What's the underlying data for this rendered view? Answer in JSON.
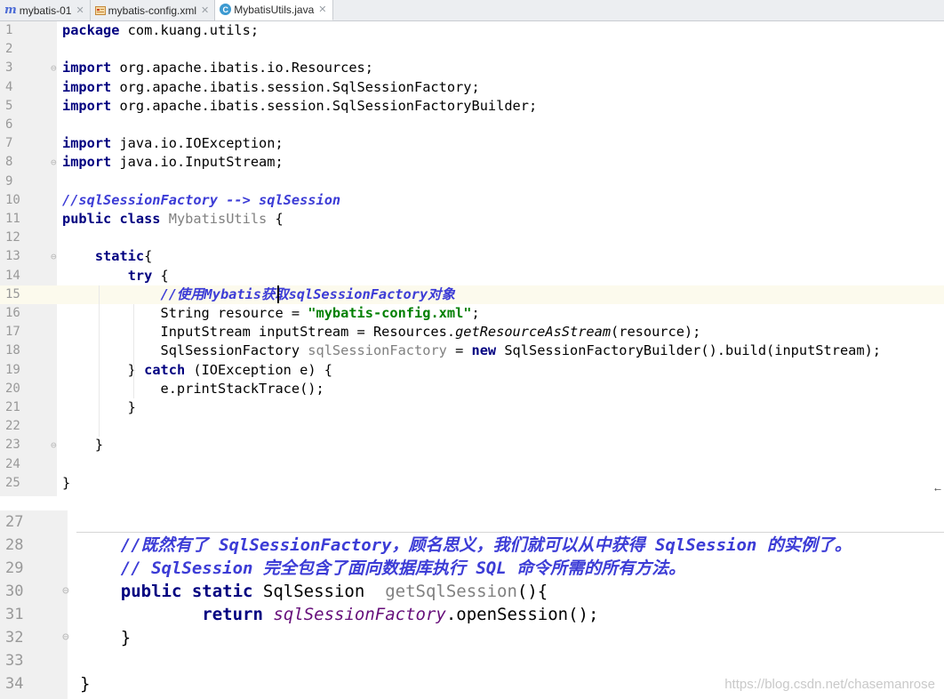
{
  "tabs": [
    {
      "label": "mybatis-01",
      "icon": "module-icon"
    },
    {
      "label": "mybatis-config.xml",
      "icon": "xml-file-icon"
    },
    {
      "label": "MybatisUtils.java",
      "icon": "java-class-icon",
      "active": true
    }
  ],
  "editor1": {
    "highlighted_line": "15",
    "lines": [
      {
        "n": "1",
        "tokens": [
          [
            "kw",
            "package"
          ],
          [
            "",
            " com.kuang.utils;"
          ]
        ]
      },
      {
        "n": "2",
        "tokens": []
      },
      {
        "n": "3",
        "fold": true,
        "tokens": [
          [
            "kw",
            "import"
          ],
          [
            "",
            " org.apache.ibatis.io.Resources;"
          ]
        ]
      },
      {
        "n": "4",
        "tokens": [
          [
            "kw",
            "import"
          ],
          [
            "",
            " org.apache.ibatis.session.SqlSessionFactory;"
          ]
        ]
      },
      {
        "n": "5",
        "tokens": [
          [
            "kw",
            "import"
          ],
          [
            "",
            " org.apache.ibatis.session.SqlSessionFactoryBuilder;"
          ]
        ]
      },
      {
        "n": "6",
        "tokens": []
      },
      {
        "n": "7",
        "tokens": [
          [
            "kw",
            "import"
          ],
          [
            "",
            " java.io.IOException;"
          ]
        ]
      },
      {
        "n": "8",
        "fold": true,
        "tokens": [
          [
            "kw",
            "import"
          ],
          [
            "",
            " java.io.InputStream;"
          ]
        ]
      },
      {
        "n": "9",
        "tokens": []
      },
      {
        "n": "10",
        "tokens": [
          [
            "cmt",
            "//sqlSessionFactory --> sqlSession"
          ]
        ]
      },
      {
        "n": "11",
        "tokens": [
          [
            "kw",
            "public class"
          ],
          [
            "",
            " "
          ],
          [
            "gray",
            "MybatisUtils"
          ],
          [
            "",
            " {"
          ]
        ]
      },
      {
        "n": "12",
        "tokens": []
      },
      {
        "n": "13",
        "fold": true,
        "tokens": [
          [
            "",
            "    "
          ],
          [
            "kw",
            "static"
          ],
          [
            "",
            "{"
          ]
        ]
      },
      {
        "n": "14",
        "tokens": [
          [
            "",
            "        "
          ],
          [
            "kw",
            "try"
          ],
          [
            "",
            " {"
          ]
        ]
      },
      {
        "n": "15",
        "tokens": [
          [
            "",
            "            "
          ],
          [
            "cmt",
            "//使用Mybatis获取sqlSessionFactory对象"
          ]
        ]
      },
      {
        "n": "16",
        "tokens": [
          [
            "",
            "            String resource = "
          ],
          [
            "str",
            "\"mybatis-config.xml\""
          ],
          [
            "",
            ";"
          ]
        ]
      },
      {
        "n": "17",
        "tokens": [
          [
            "",
            "            InputStream inputStream = Resources."
          ],
          [
            "ital",
            "getResourceAsStream"
          ],
          [
            "",
            "(resource);"
          ]
        ]
      },
      {
        "n": "18",
        "tokens": [
          [
            "",
            "            SqlSessionFactory "
          ],
          [
            "gray",
            "sqlSessionFactory"
          ],
          [
            "",
            " = "
          ],
          [
            "kw",
            "new"
          ],
          [
            "",
            " SqlSessionFactoryBuilder().build(inputStream);"
          ]
        ]
      },
      {
        "n": "19",
        "tokens": [
          [
            "",
            "        } "
          ],
          [
            "kw",
            "catch"
          ],
          [
            "",
            " (IOException e) {"
          ]
        ]
      },
      {
        "n": "20",
        "tokens": [
          [
            "",
            "            e.printStackTrace();"
          ]
        ]
      },
      {
        "n": "21",
        "tokens": [
          [
            "",
            "        }"
          ]
        ]
      },
      {
        "n": "22",
        "tokens": []
      },
      {
        "n": "23",
        "fold": true,
        "tokens": [
          [
            "",
            "    }"
          ]
        ]
      },
      {
        "n": "24",
        "tokens": []
      },
      {
        "n": "25",
        "tokens": [
          [
            "",
            "}"
          ]
        ]
      }
    ]
  },
  "editor2": {
    "lines": [
      {
        "n": "27",
        "tokens": []
      },
      {
        "n": "28",
        "tokens": [
          [
            "",
            "    "
          ],
          [
            "cmt",
            "//既然有了 SqlSessionFactory，顾名思义，我们就可以从中获得 SqlSession 的实例了。"
          ]
        ]
      },
      {
        "n": "29",
        "tokens": [
          [
            "",
            "    "
          ],
          [
            "cmt",
            "// SqlSession 完全包含了面向数据库执行 SQL 命令所需的所有方法。"
          ]
        ]
      },
      {
        "n": "30",
        "fold": true,
        "tokens": [
          [
            "",
            "    "
          ],
          [
            "kw",
            "public static"
          ],
          [
            "",
            " SqlSession  "
          ],
          [
            "gray",
            "getSqlSession"
          ],
          [
            "",
            "(){"
          ]
        ]
      },
      {
        "n": "31",
        "tokens": [
          [
            "",
            "            "
          ],
          [
            "kw",
            "return"
          ],
          [
            "",
            " "
          ],
          [
            "ital-purple",
            "sqlSessionFactory"
          ],
          [
            "",
            ".openSession();"
          ]
        ]
      },
      {
        "n": "32",
        "fold": true,
        "tokens": [
          [
            "",
            "    }"
          ]
        ]
      },
      {
        "n": "33",
        "tokens": []
      },
      {
        "n": "34",
        "tokens": [
          [
            "",
            "}"
          ]
        ]
      }
    ]
  },
  "watermark": "https://blog.csdn.net/chasemanrose"
}
